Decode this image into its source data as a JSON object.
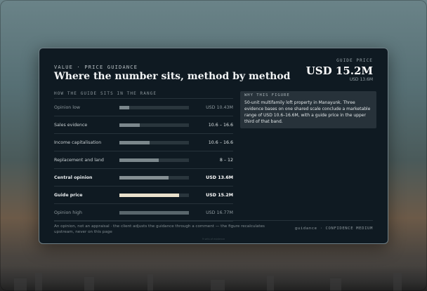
{
  "header": {
    "eyebrow": "VALUE · PRICE GUIDANCE",
    "title": "Where the number sits, method by method",
    "guide_label": "GUIDE PRICE",
    "guide_value": "USD 15.2M",
    "guide_sub": "USD 13.6M"
  },
  "section_head": "HOW THE GUIDE SITS IN THE RANGE",
  "rows": [
    {
      "label": "Opinion low",
      "value": "USD 10.43M",
      "fill": 0.14,
      "style": "dim",
      "color": "#7b878c"
    },
    {
      "label": "Sales evidence",
      "value": "10.6 – 16.6",
      "fill": 0.29,
      "style": "normal",
      "color": "#7b878c"
    },
    {
      "label": "Income capitalisation",
      "value": "10.6 – 16.6",
      "fill": 0.43,
      "style": "normal",
      "color": "#7b878c"
    },
    {
      "label": "Replacement and land",
      "value": "8 – 12",
      "fill": 0.57,
      "style": "normal",
      "color": "#7b878c"
    },
    {
      "label": "Central opinion",
      "value": "USD 13.6M",
      "fill": 0.71,
      "style": "bold",
      "color": "#858f93"
    },
    {
      "label": "Guide price",
      "value": "USD 15.2M",
      "fill": 0.86,
      "style": "bold",
      "color": "#e9e1cc"
    },
    {
      "label": "Opinion high",
      "value": "USD 16.77M",
      "fill": 1.0,
      "style": "dim",
      "color": "#59666c"
    }
  ],
  "note": {
    "head": "WHY THIS FIGURE",
    "body": "50-unit multifamily loft property in Manayunk. Three evidence bases on one shared scale conclude a marketable range of USD 10.6–16.6M, with a guide price in the upper third of that band."
  },
  "footer": {
    "text": "An opinion, not an appraisal · the client adjusts the guidance through a comment — the figure recalculates upstream, never on this page",
    "right": "guidance · CONFIDENCE MEDIUM",
    "tiny": "9 sets of evidence"
  }
}
